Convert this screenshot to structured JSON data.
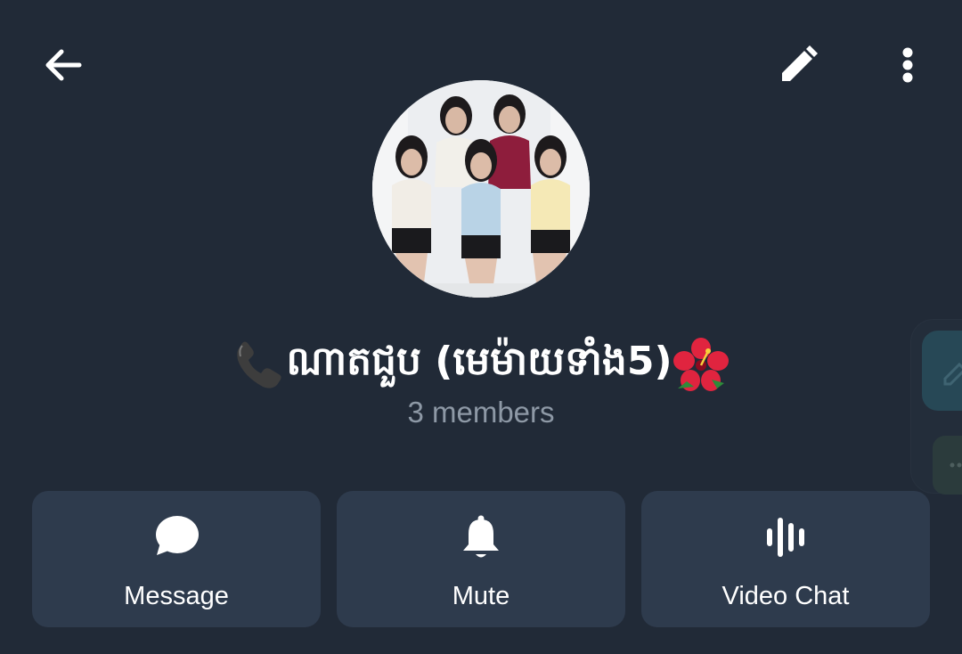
{
  "header": {
    "back_icon": "arrow-left-icon",
    "edit_icon": "pencil-icon",
    "more_icon": "more-vertical-icon"
  },
  "profile": {
    "avatar": "group-photo",
    "title": "ណាតជួប (មេម៉ាយទាំង5)",
    "title_prefix_emoji": "📞",
    "title_suffix_emoji": "🌺",
    "members": "3 members"
  },
  "actions": [
    {
      "label": "Message",
      "icon": "chat-bubble-icon"
    },
    {
      "label": "Mute",
      "icon": "bell-icon"
    },
    {
      "label": "Video Chat",
      "icon": "voice-chat-icon"
    }
  ],
  "side_panel": {
    "edit_icon": "pencil-icon",
    "more_icon": "more-horizontal-icon"
  },
  "colors": {
    "background": "#212a37",
    "button_bg": "#2e3b4d",
    "text_primary": "#ffffff",
    "text_secondary": "#8e99a6",
    "side_edit_bg": "#274856"
  }
}
